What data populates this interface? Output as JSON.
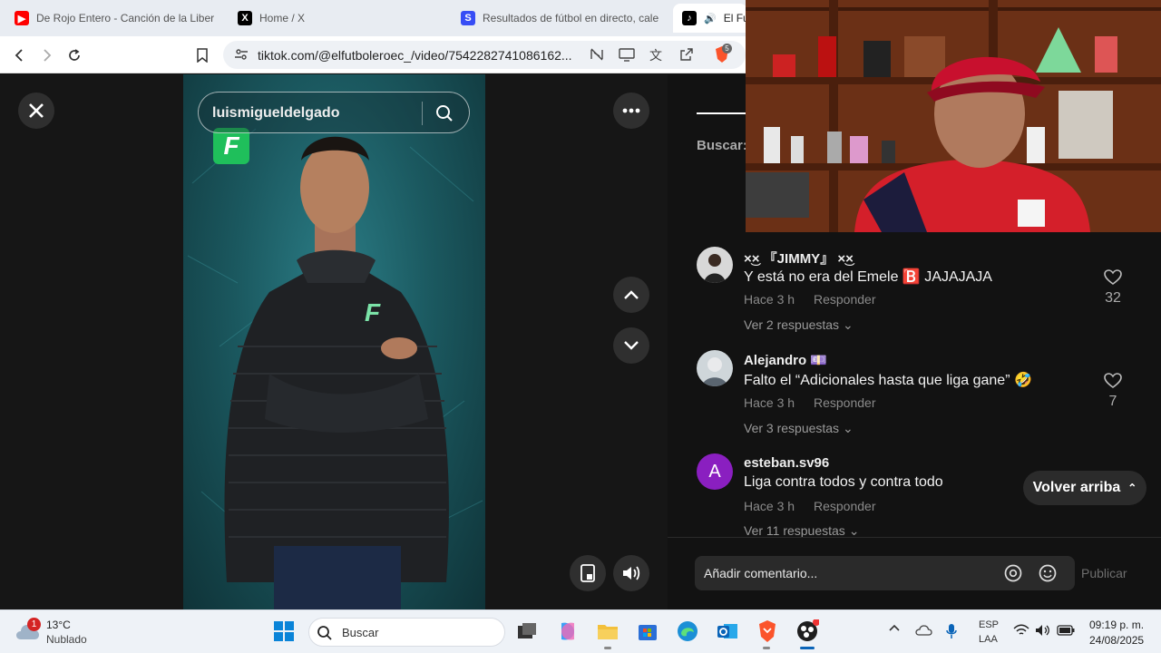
{
  "tabs": [
    {
      "title": "De Rojo Entero - Canción de la Liber",
      "icon": "youtube-icon"
    },
    {
      "title": "Home / X",
      "icon": "x-icon"
    },
    {
      "title": "Resultados de fútbol en directo, cale",
      "icon": "sofascore-icon"
    },
    {
      "title": "El Fut",
      "icon": "tiktok-icon"
    }
  ],
  "address": {
    "url": "tiktok.com/@elfutboleroec_/video/7542282741086162..."
  },
  "extension_badge": "5",
  "player": {
    "search_text": "luismigueldelgado",
    "logo_letter": "F"
  },
  "comments_panel": {
    "search_label": "Buscar:",
    "comments": [
      {
        "author": "×͜× 『JIMMY』 ×͜×",
        "text": "Y está no era del Emele 🅱️ JAJAJAJA",
        "time": "Hace 3 h",
        "reply": "Responder",
        "likes": "32",
        "replies": "Ver 2 respuestas"
      },
      {
        "author": "Alejandro 💷",
        "text": "Falto el “Adicionales hasta que liga gane” 🤣",
        "time": "Hace 3 h",
        "reply": "Responder",
        "likes": "7",
        "replies": "Ver 3 respuestas"
      },
      {
        "author": "esteban.sv96",
        "text": "Liga contra todos y contra todo",
        "time": "Hace 3 h",
        "reply": "Responder",
        "likes": "",
        "replies": "Ver 11 respuestas",
        "avatar_letter": "A"
      }
    ],
    "back_to_top": "Volver arriba",
    "add_comment_placeholder": "Añadir comentario...",
    "publish": "Publicar"
  },
  "taskbar": {
    "weather_temp": "13°C",
    "weather_desc": "Nublado",
    "weather_badge": "1",
    "search": "Buscar",
    "lang_top": "ESP",
    "lang_bottom": "LAA",
    "time": "09:19 p. m.",
    "date": "24/08/2025"
  },
  "colors": {
    "tiktok_bg": "#121212",
    "accent_red": "#fe2c55",
    "logo_green": "#1fbf5b"
  }
}
